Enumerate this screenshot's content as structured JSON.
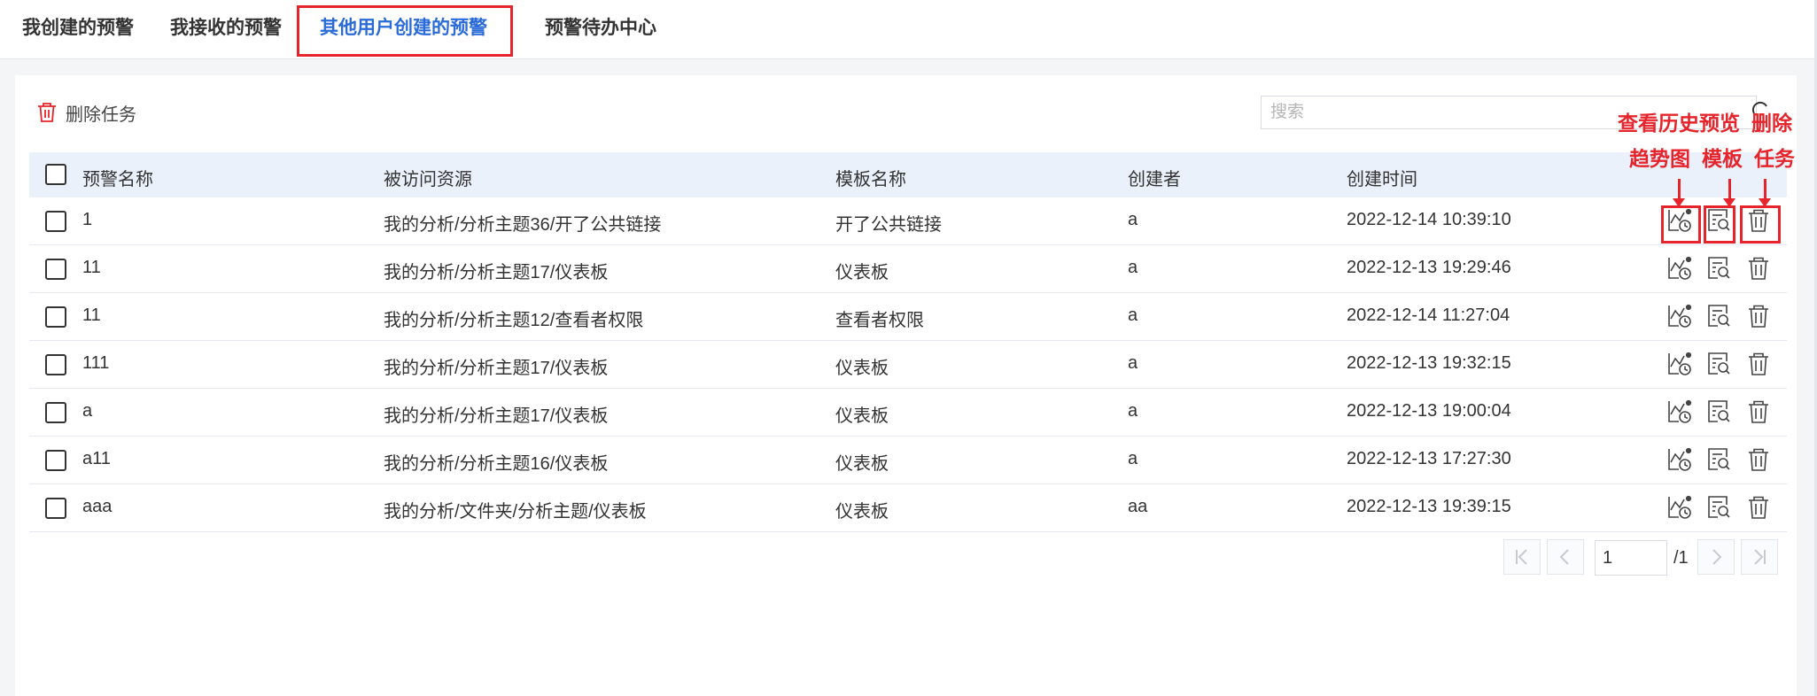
{
  "tabs": [
    {
      "label": "我创建的预警"
    },
    {
      "label": "我接收的预警"
    },
    {
      "label": "其他用户创建的预警"
    },
    {
      "label": "预警待办中心"
    }
  ],
  "toolbar": {
    "delete_label": "删除任务"
  },
  "search": {
    "placeholder": "搜索",
    "value": ""
  },
  "table": {
    "headers": {
      "name": "预警名称",
      "resource": "被访问资源",
      "template": "模板名称",
      "creator": "创建者",
      "created": "创建时间"
    },
    "rows": [
      {
        "name": "1",
        "resource": "我的分析/分析主题36/开了公共链接",
        "template": "开了公共链接",
        "creator": "a",
        "created": "2022-12-14 10:39:10"
      },
      {
        "name": "11",
        "resource": "我的分析/分析主题17/仪表板",
        "template": "仪表板",
        "creator": "a",
        "created": "2022-12-13 19:29:46"
      },
      {
        "name": "11",
        "resource": "我的分析/分析主题12/查看者权限",
        "template": "查看者权限",
        "creator": "a",
        "created": "2022-12-14 11:27:04"
      },
      {
        "name": "111",
        "resource": "我的分析/分析主题17/仪表板",
        "template": "仪表板",
        "creator": "a",
        "created": "2022-12-13 19:32:15"
      },
      {
        "name": "a",
        "resource": "我的分析/分析主题17/仪表板",
        "template": "仪表板",
        "creator": "a",
        "created": "2022-12-13 19:00:04"
      },
      {
        "name": "a11",
        "resource": "我的分析/分析主题16/仪表板",
        "template": "仪表板",
        "creator": "a",
        "created": "2022-12-13 17:27:30"
      },
      {
        "name": "aaa",
        "resource": "我的分析/文件夹/分析主题/仪表板",
        "template": "仪表板",
        "creator": "aa",
        "created": "2022-12-13 19:39:15"
      }
    ]
  },
  "annotations": {
    "trend_line1": "查看历史",
    "trend_line2": "趋势图",
    "preview_line1": "预览",
    "preview_line2": "模板",
    "delete_line1": "删除",
    "delete_line2": "任务"
  },
  "pagination": {
    "current": "1",
    "total": "/1"
  },
  "colors": {
    "accent": "#2a6bd8",
    "annotation": "#e5242b",
    "header_bg": "#ebf1fb"
  },
  "icons": [
    "trash-icon",
    "search-icon",
    "history-trend-icon",
    "preview-template-icon",
    "first-page-icon",
    "prev-page-icon",
    "next-page-icon",
    "last-page-icon"
  ]
}
